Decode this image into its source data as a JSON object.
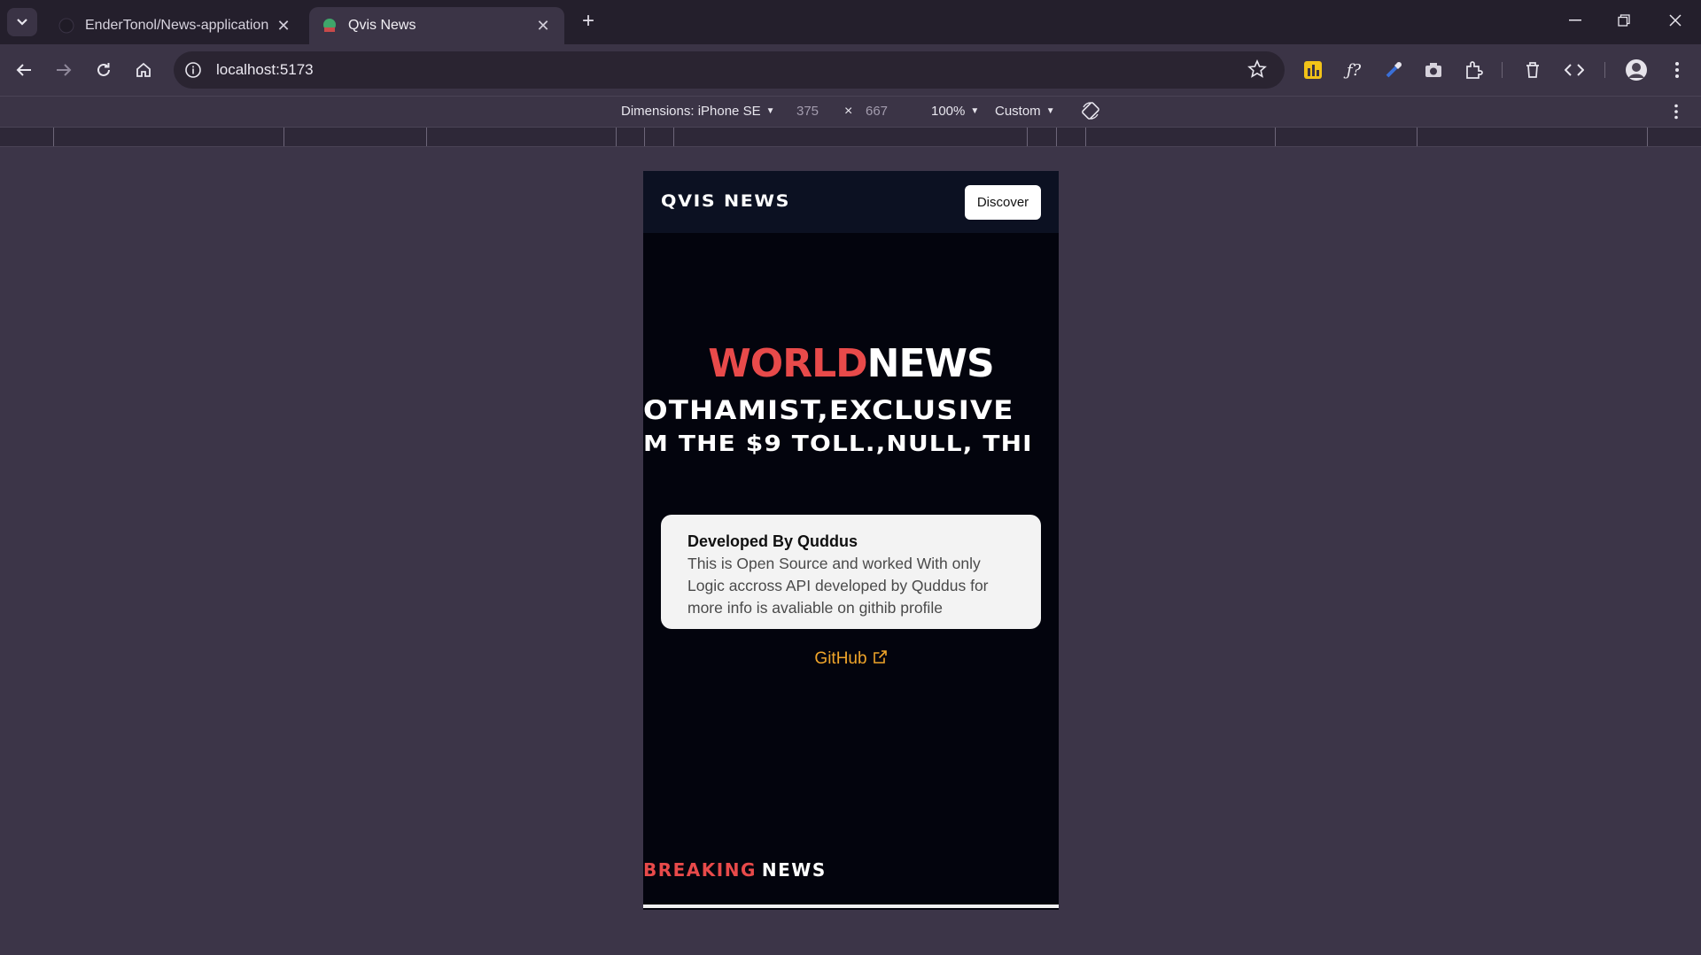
{
  "browser": {
    "tabs": [
      {
        "title": "EnderTonol/News-application",
        "active": false,
        "favicon": "github-icon"
      },
      {
        "title": "Qvis News",
        "active": true,
        "favicon": "qvis-favicon"
      }
    ],
    "url": "localhost:5173",
    "accent": "#3b3446"
  },
  "devtools": {
    "dimensions_label": "Dimensions: iPhone SE",
    "width": "375",
    "times": "×",
    "height": "667",
    "zoom": "100%",
    "throttle": "Custom"
  },
  "app": {
    "brand": "QVIS NEWS",
    "discover_label": "Discover",
    "headline_red": "WORLD",
    "headline_white": "NEWS",
    "ticker_line1": "OTHAMIST,EXCLUSIVE",
    "ticker_line2": "M THE $9 TOLL.,NULL, THI",
    "card": {
      "title": "Developed By Quddus",
      "body": "This is Open Source and worked With only Logic accross API developed by Quddus for more info is avaliable on githib profile"
    },
    "github_label": "GitHub",
    "breaking_red": "BREAKING",
    "breaking_white": "NEWS",
    "colors": {
      "red": "#e84a4a",
      "link": "#f0a52a",
      "background": "#03040d"
    }
  }
}
